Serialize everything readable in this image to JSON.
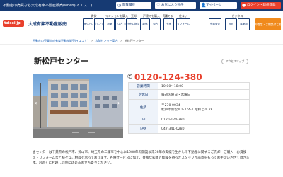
{
  "topbar": {
    "tagline": "不動産の売買なら大成有楽不動産販売(when)(イエス！)",
    "links": [
      {
        "label": "閲覧履歴",
        "icon": "clock-icon"
      },
      {
        "label": "お気に入り物件",
        "icon": "heart-icon"
      },
      {
        "label": "マイページ",
        "icon": "user-icon"
      }
    ],
    "login_label": "ログイン・新規登録"
  },
  "header": {
    "logo_text": "taisei.jp",
    "company": "大成有楽不動産販売",
    "nav_groups": [
      {
        "title": "賃貸",
        "buttons": [
          {
            "label": "借りたい",
            "dark": false
          },
          {
            "label": "貸したい",
            "dark": false
          }
        ]
      },
      {
        "title": "マンションを購入・売却",
        "buttons": [
          {
            "label": "新築",
            "dark": false
          },
          {
            "label": "中古",
            "dark": false
          },
          {
            "label": "自社売主物件",
            "dark": false
          }
        ]
      },
      {
        "title": "一戸建てを購入・売却",
        "buttons": [
          {
            "label": "新築",
            "dark": false
          },
          {
            "label": "中古",
            "dark": false
          }
        ]
      },
      {
        "title": "建てる",
        "buttons": [
          {
            "label": "土地",
            "dark": false
          }
        ]
      },
      {
        "title": "住まい",
        "buttons": [
          {
            "label": "リフォーム",
            "dark": false
          }
        ]
      },
      {
        "title": "",
        "buttons": [
          {
            "label": "売却査定",
            "dark": false
          }
        ]
      },
      {
        "title": "ビジネス",
        "buttons": [
          {
            "label": "投資",
            "dark": false
          },
          {
            "label": "事業用",
            "dark": false
          }
        ]
      }
    ],
    "consult_label": "売却査定・ご相談はこちら"
  },
  "breadcrumb": [
    "不動産の売買大成有楽不動産販売(イエス！)",
    "店舗センター案内",
    "新松戸センター"
  ],
  "store": {
    "name": "新松戸センター",
    "access_label": "アクセスマップ",
    "phone": "0120-124-380",
    "info": [
      {
        "key": "営業時間",
        "value": "10:00〜18:00"
      },
      {
        "key": "定休日",
        "value": "毎週火曜日・水曜日"
      },
      {
        "key": "住所",
        "value": "〒270-0034",
        "value2": "松戸市新松戸1-374-1 昭和ビル 2F"
      },
      {
        "key": "TEL",
        "value": "0120-124-380"
      },
      {
        "key": "FAX",
        "value": "047-341-0280"
      }
    ],
    "description": "当センターは千葉県の松戸市、流山市、埼玉県の三郷市を中心に1988年の開設以来36年の実績を生かして不動産に関するご売却・ご購入・お貸換え・リフォームなど様々なご相談を承っております。各種サービスに加え、豊富な知識と経験を持ったスタッフが誠意をもってお手伝いさせて頂きます。お近くにお越しの際には是非お立ち寄りください。"
  },
  "colors": {
    "navy": "#163a73",
    "accent": "#e8402c",
    "orange": "#f08a1c"
  }
}
